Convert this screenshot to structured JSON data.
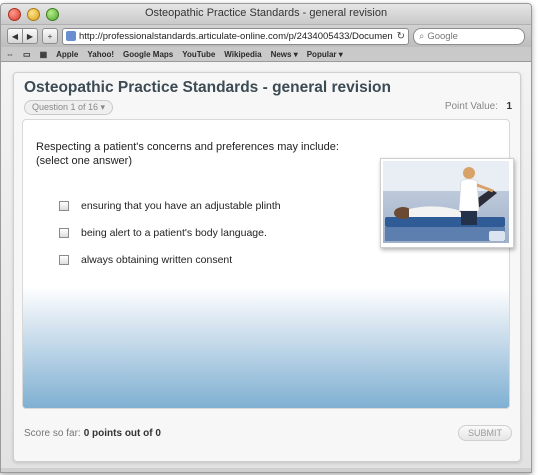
{
  "outer": {
    "fragment": "20"
  },
  "browser": {
    "window_title": "Osteopathic Practice Standards - general revision",
    "url": "http://professionalstandards.articulate-online.com/p/2434005433/Documen",
    "search_placeholder": "Google",
    "bookmarks": [
      "Apple",
      "Yahoo!",
      "Google Maps",
      "YouTube",
      "Wikipedia",
      "News ▾",
      "Popular ▾"
    ]
  },
  "quiz": {
    "title": "Osteopathic Practice Standards - general revision",
    "question_selector": "Question 1 of 16 ▾",
    "point_value_label": "Point Value:",
    "point_value": "1",
    "question_text": "Respecting a patient's concerns and preferences may include: (select one answer)",
    "answers": [
      "ensuring that you have an adjustable plinth",
      "being alert to a patient's body language.",
      "always obtaining written consent"
    ],
    "score_label": "Score so far:",
    "score_value": "0 points out of 0",
    "submit_label": "SUBMIT"
  },
  "colors": {
    "title_text": "#3d4b55",
    "panel_gradient_bottom": "#7fb0d2"
  }
}
